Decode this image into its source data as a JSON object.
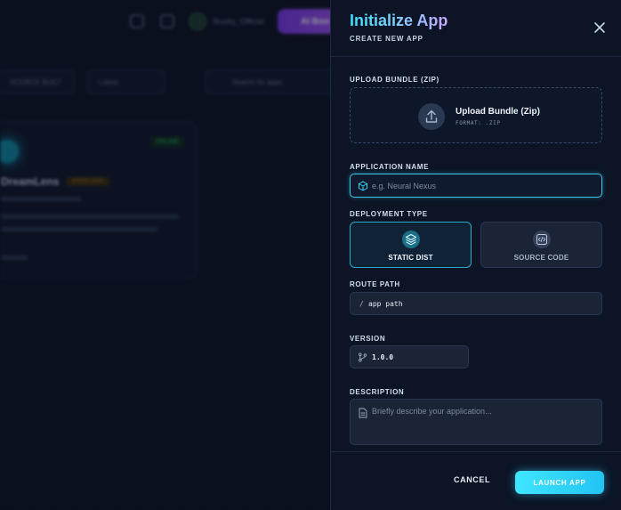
{
  "background": {
    "topbar_user": "Bucky_Official",
    "topbar_button": "AI Boo",
    "filter_source": "SOURCE BUILT",
    "filter_sort": "Latest",
    "search_placeholder": "Search for apps",
    "card": {
      "status": "ONLINE",
      "name": "DreamLens",
      "tag": "STATIC DIST"
    }
  },
  "panel": {
    "title": "Initialize App",
    "subtitle": "CREATE NEW APP"
  },
  "upload": {
    "label": "UPLOAD BUNDLE (ZIP)",
    "title": "Upload Bundle (Zip)",
    "format": "FORMAT: .ZIP"
  },
  "app_name": {
    "label": "APPLICATION NAME",
    "placeholder": "e.g. Neural Nexus"
  },
  "deployment": {
    "label": "DEPLOYMENT TYPE",
    "options": [
      {
        "label": "STATIC DIST",
        "selected": true
      },
      {
        "label": "SOURCE CODE",
        "selected": false
      }
    ]
  },
  "route": {
    "label": "ROUTE PATH",
    "prefix": "/",
    "value": "app path"
  },
  "version": {
    "label": "VERSION",
    "value": "1.0.0"
  },
  "description": {
    "label": "DESCRIPTION",
    "placeholder": "Briefly describe your application..."
  },
  "footer": {
    "cancel": "CANCEL",
    "launch": "LAUNCH APP"
  },
  "colors": {
    "accent": "#38e1ff",
    "panel_bg": "#0c1426",
    "input_bg": "#1b2336"
  }
}
